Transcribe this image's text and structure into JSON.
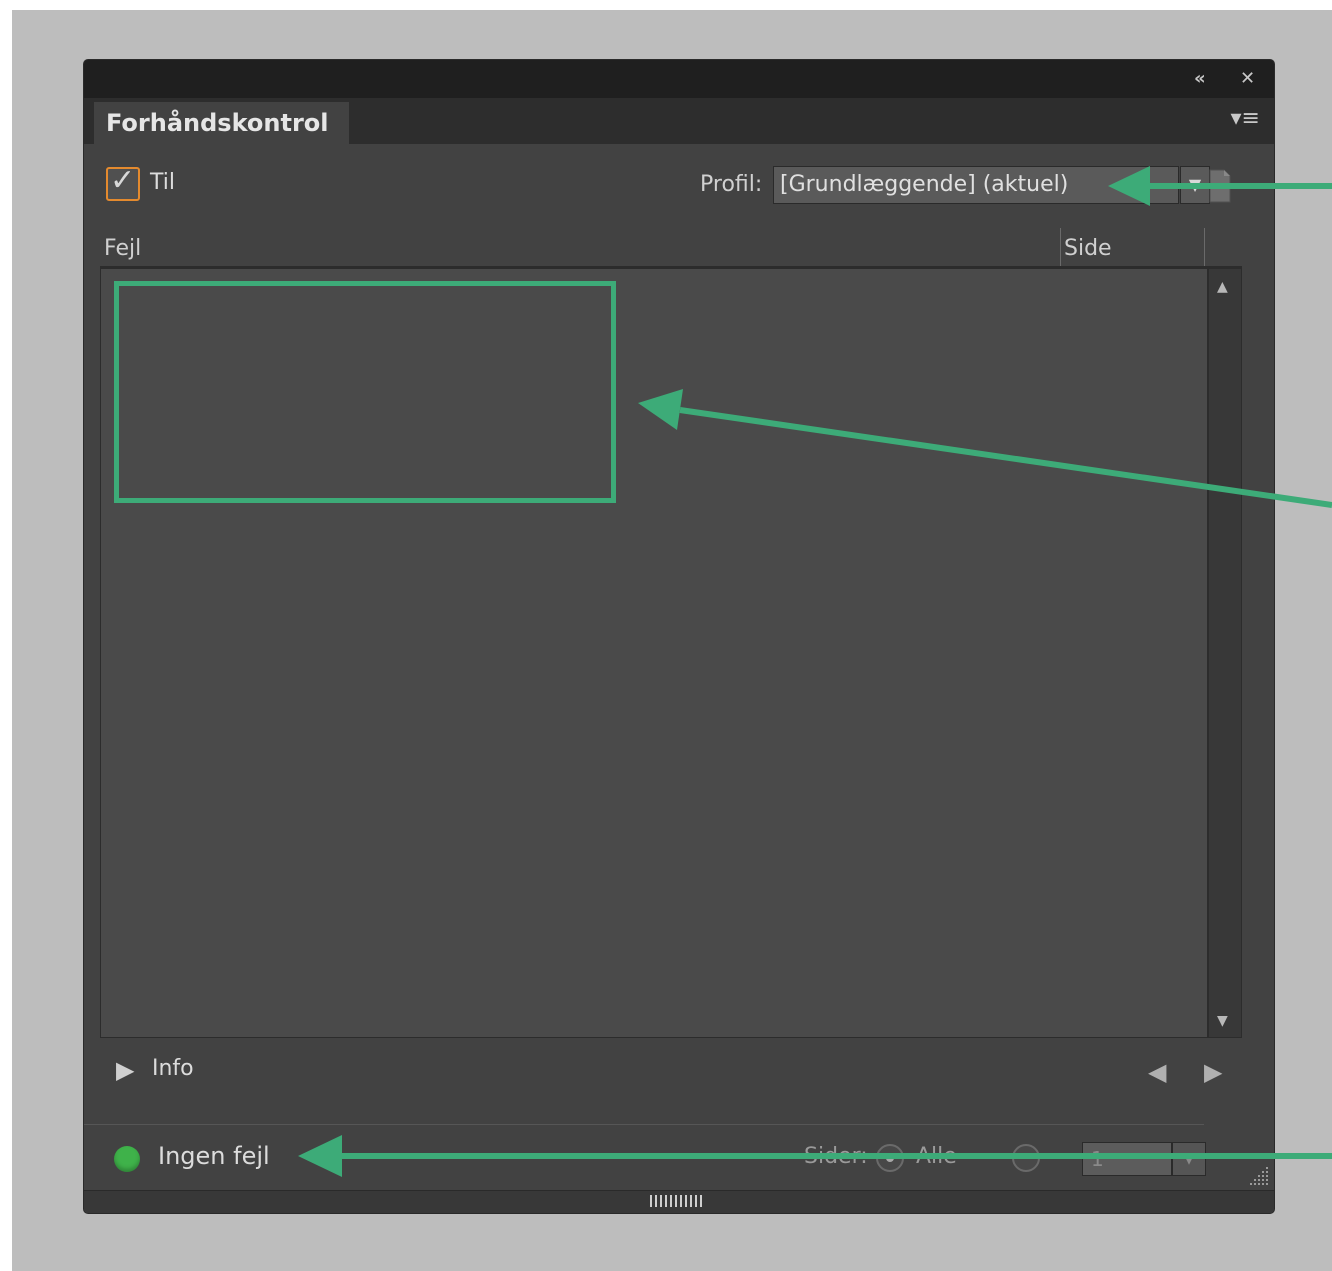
{
  "panel": {
    "collapse_icon": "double-chevron-left-icon",
    "close_icon": "close-icon",
    "tab_title": "Forhåndskontrol",
    "menu_icon": "panel-menu-icon"
  },
  "toolbar": {
    "enable_checked": true,
    "enable_label": "Til",
    "profile_label": "Profil:",
    "profile_value": "[Grundlæggende] (aktuel)",
    "profile_doc_icon": "document-profile-icon"
  },
  "list": {
    "columns": [
      "Fejl",
      "Side"
    ],
    "rows": []
  },
  "info": {
    "label": "Info",
    "toggle_icon": "disclosure-triangle-icon",
    "prev_icon": "chevron-left-icon",
    "next_icon": "chevron-right-icon"
  },
  "status": {
    "label": "Ingen fejl",
    "color": "#3fb24a",
    "pages_label": "Sider:",
    "all_label": "Alle",
    "page_range_value": "1"
  },
  "annotations": {
    "color": "#3dab78"
  }
}
